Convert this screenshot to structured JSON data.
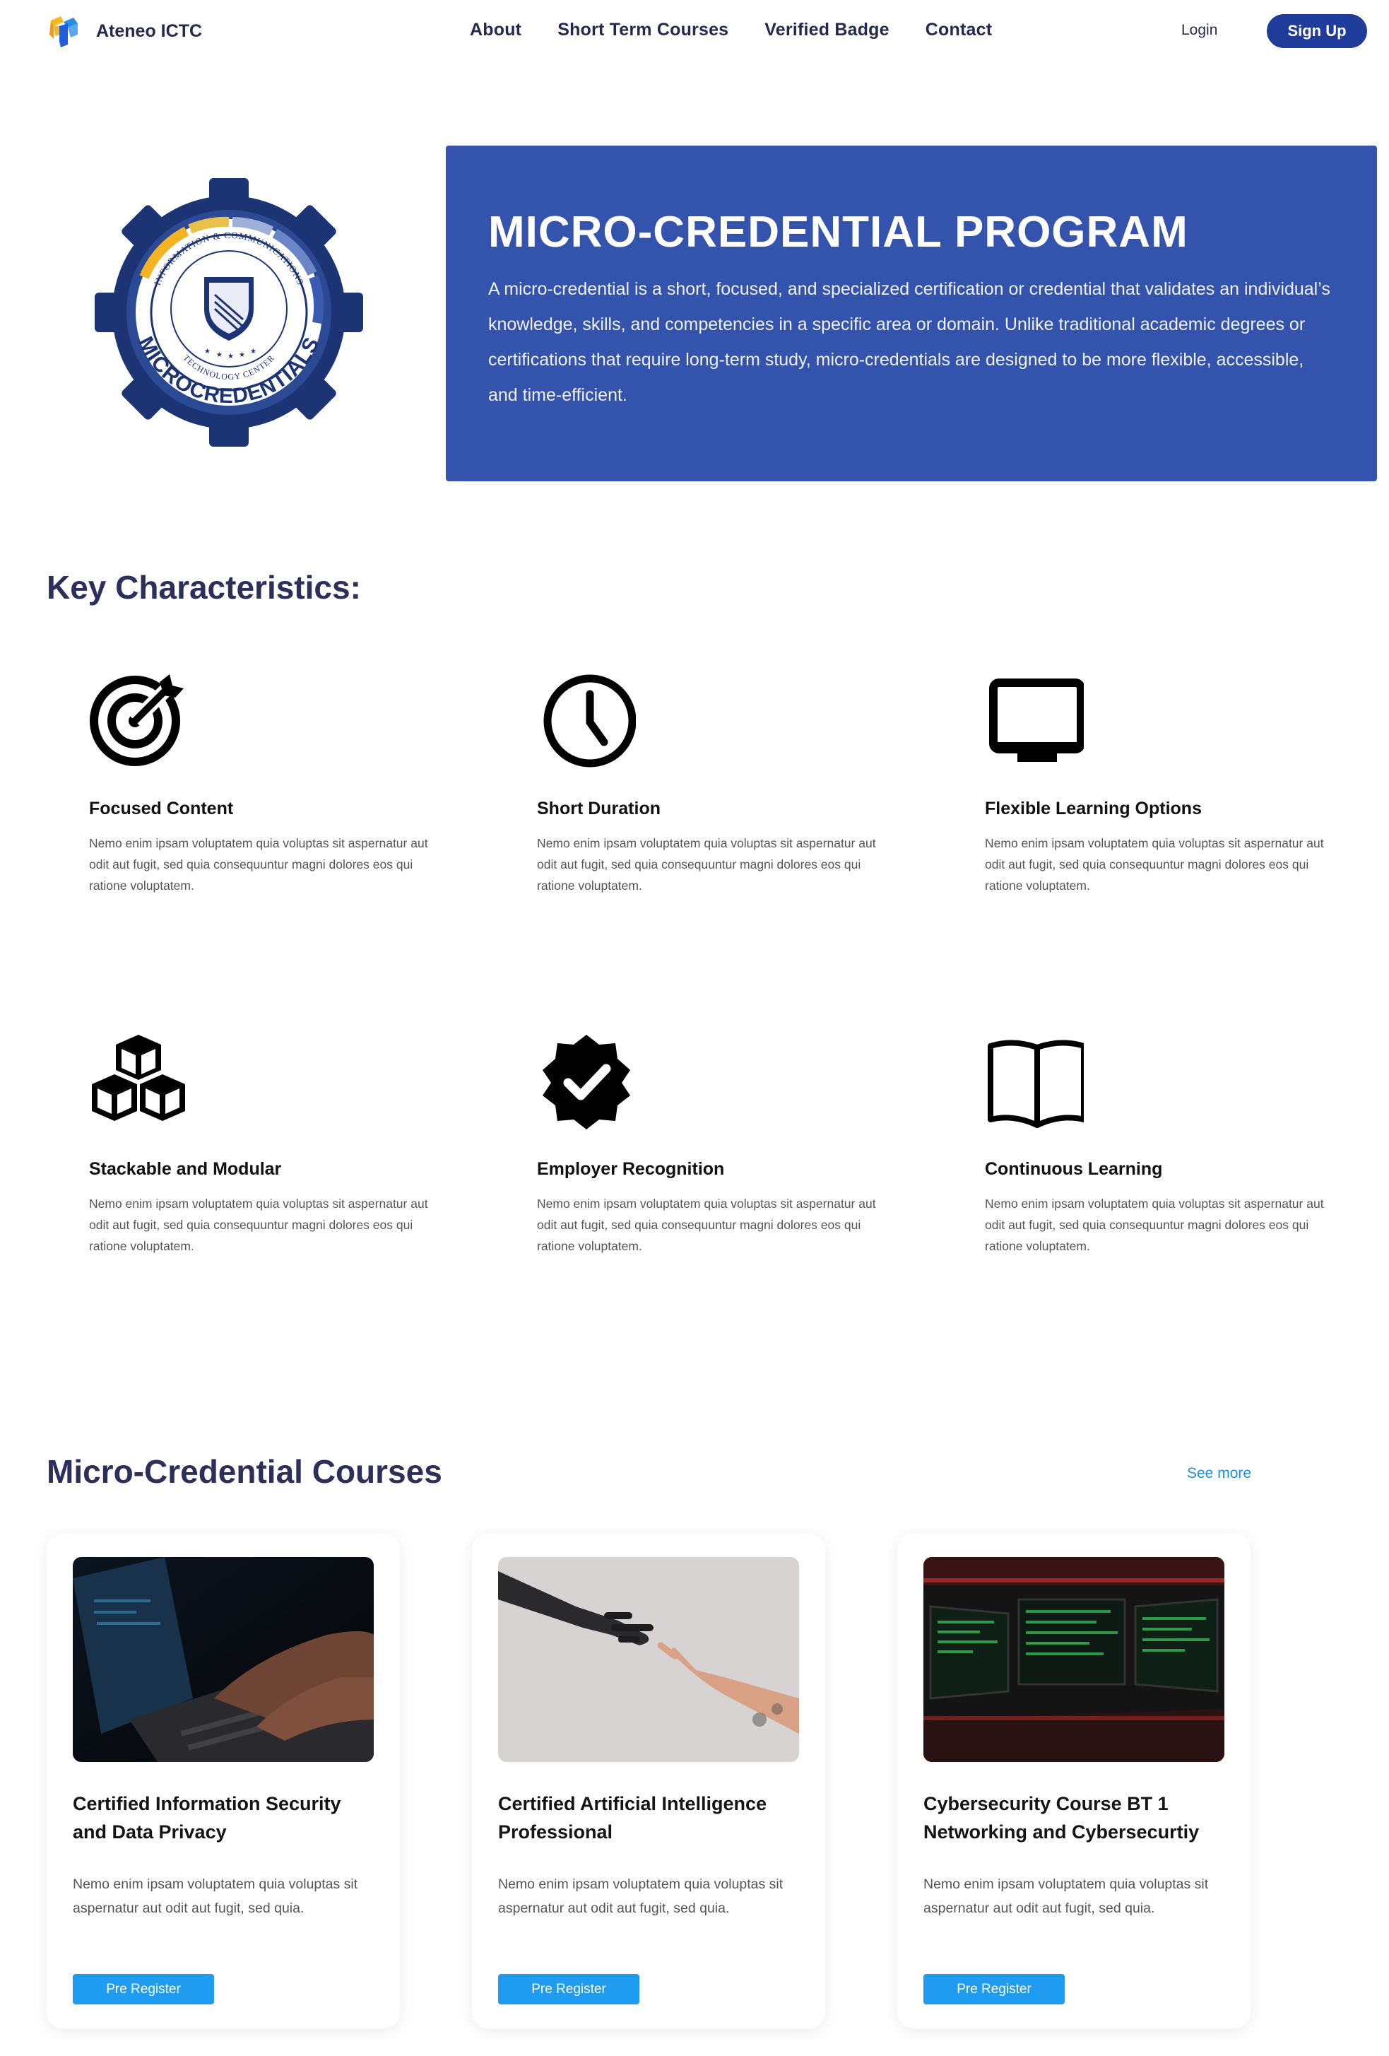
{
  "nav": {
    "brand": "Ateneo ICTC",
    "links": [
      "About",
      "Short Term Courses",
      "Verified Badge",
      "Contact"
    ],
    "login": "Login",
    "signup": "Sign Up"
  },
  "hero": {
    "emblem_text": {
      "ring": "INFORMATION & COMMUNICATIONS",
      "ring_bottom": "TECHNOLOGY CENTER",
      "arc": "MICROCREDENTIALS"
    },
    "title": "MICRO-CREDENTIAL PROGRAM",
    "description": "A micro-credential is a short, focused, and specialized certification or credential that validates an individual’s knowledge, skills, and competencies in a specific area or domain. Unlike traditional academic degrees or certifications that require long-term study, micro-credentials are designed to be more flexible, accessible, and time-efficient."
  },
  "key_characteristics": {
    "title": "Key Characteristics:",
    "items": [
      {
        "icon": "target-icon",
        "name": "Focused Content",
        "desc": "Nemo enim ipsam voluptatem quia voluptas sit aspernatur aut odit aut fugit, sed quia consequuntur magni dolores eos qui ratione voluptatem."
      },
      {
        "icon": "clock-icon",
        "name": "Short Duration",
        "desc": "Nemo enim ipsam voluptatem quia voluptas sit aspernatur aut odit aut fugit, sed quia consequuntur magni dolores eos qui ratione voluptatem."
      },
      {
        "icon": "monitor-icon",
        "name": "Flexible Learning Options",
        "desc": "Nemo enim ipsam voluptatem quia voluptas sit aspernatur aut odit aut fugit, sed quia consequuntur magni dolores eos qui ratione voluptatem."
      },
      {
        "icon": "cubes-icon",
        "name": "Stackable and Modular",
        "desc": "Nemo enim ipsam voluptatem quia voluptas sit aspernatur aut odit aut fugit, sed quia consequuntur magni dolores eos qui ratione voluptatem."
      },
      {
        "icon": "verified-badge-icon",
        "name": "Employer Recognition",
        "desc": "Nemo enim ipsam voluptatem quia voluptas sit aspernatur aut odit aut fugit, sed quia consequuntur magni dolores eos qui ratione voluptatem."
      },
      {
        "icon": "open-book-icon",
        "name": "Continuous Learning",
        "desc": "Nemo enim ipsam voluptatem quia voluptas sit aspernatur aut odit aut fugit, sed quia consequuntur magni dolores eos qui ratione voluptatem."
      }
    ]
  },
  "courses": {
    "title": "Micro-Credential Courses",
    "see_more": "See more",
    "items": [
      {
        "title": "Certified Information Security and Data Privacy",
        "desc": "Nemo enim ipsam voluptatem quia voluptas sit aspernatur aut odit aut fugit, sed quia.",
        "button": "Pre Register"
      },
      {
        "title": "Certified Artificial Intelligence Professional",
        "desc": "Nemo enim ipsam voluptatem quia voluptas sit aspernatur aut odit aut fugit, sed quia.",
        "button": "Pre Register"
      },
      {
        "title": "Cybersecurity Course BT 1 Networking and Cybersecurtiy",
        "desc": "Nemo enim ipsam voluptatem quia voluptas sit aspernatur aut odit aut fugit, sed quia.",
        "button": "Pre Register"
      }
    ]
  },
  "colors": {
    "hero_bg": "#3353ad",
    "signup_bg": "#1f3c9a",
    "button_bg": "#1f9bf0",
    "heading": "#2c2f5a"
  }
}
